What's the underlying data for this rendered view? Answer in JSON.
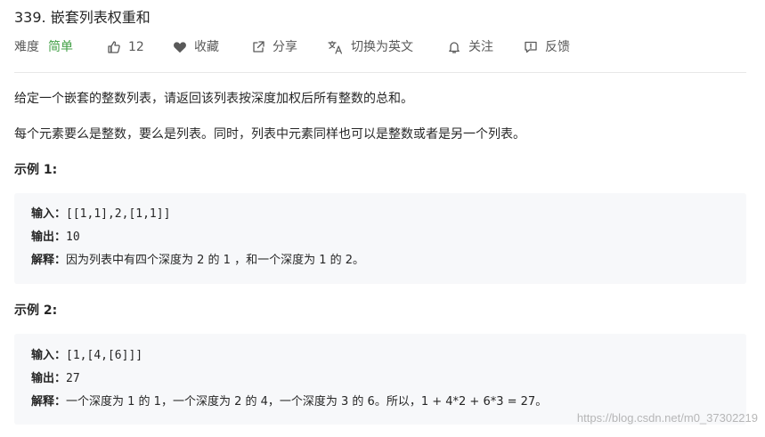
{
  "problem": {
    "title": "339. 嵌套列表权重和"
  },
  "meta": {
    "difficulty_label": "难度",
    "difficulty_value": "简单",
    "like_count": "12",
    "favorite_label": "收藏",
    "share_label": "分享",
    "switch_language_label": "切换为英文",
    "follow_label": "关注",
    "feedback_label": "反馈"
  },
  "description": {
    "paragraph_1": "给定一个嵌套的整数列表，请返回该列表按深度加权后所有整数的总和。",
    "paragraph_2": "每个元素要么是整数，要么是列表。同时，列表中元素同样也可以是整数或者是另一个列表。"
  },
  "examples": [
    {
      "heading": "示例 1:",
      "input_label": "输入：",
      "input_value": "[[1,1],2,[1,1]]",
      "output_label": "输出：",
      "output_value": "10",
      "explain_label": "解释：",
      "explain_value": "因为列表中有四个深度为 2 的 1 ，和一个深度为 1 的 2。"
    },
    {
      "heading": "示例 2:",
      "input_label": "输入：",
      "input_value": "[1,[4,[6]]]",
      "output_label": "输出：",
      "output_value": "27",
      "explain_label": "解释：",
      "explain_value": "一个深度为 1 的 1，一个深度为 2 的 4，一个深度为 3 的 6。所以，1 + 4*2 + 6*3 = 27。"
    }
  ],
  "watermark": "https://blog.csdn.net/m0_37302219",
  "colors": {
    "easy": "#43a047",
    "text": "#262626",
    "muted": "#595959",
    "example_bg": "#f7f8fa"
  },
  "icons": {
    "like": "thumbs-up-icon",
    "favorite": "heart-icon",
    "share": "share-icon",
    "language": "translate-icon",
    "follow": "bell-icon",
    "feedback": "feedback-icon"
  }
}
